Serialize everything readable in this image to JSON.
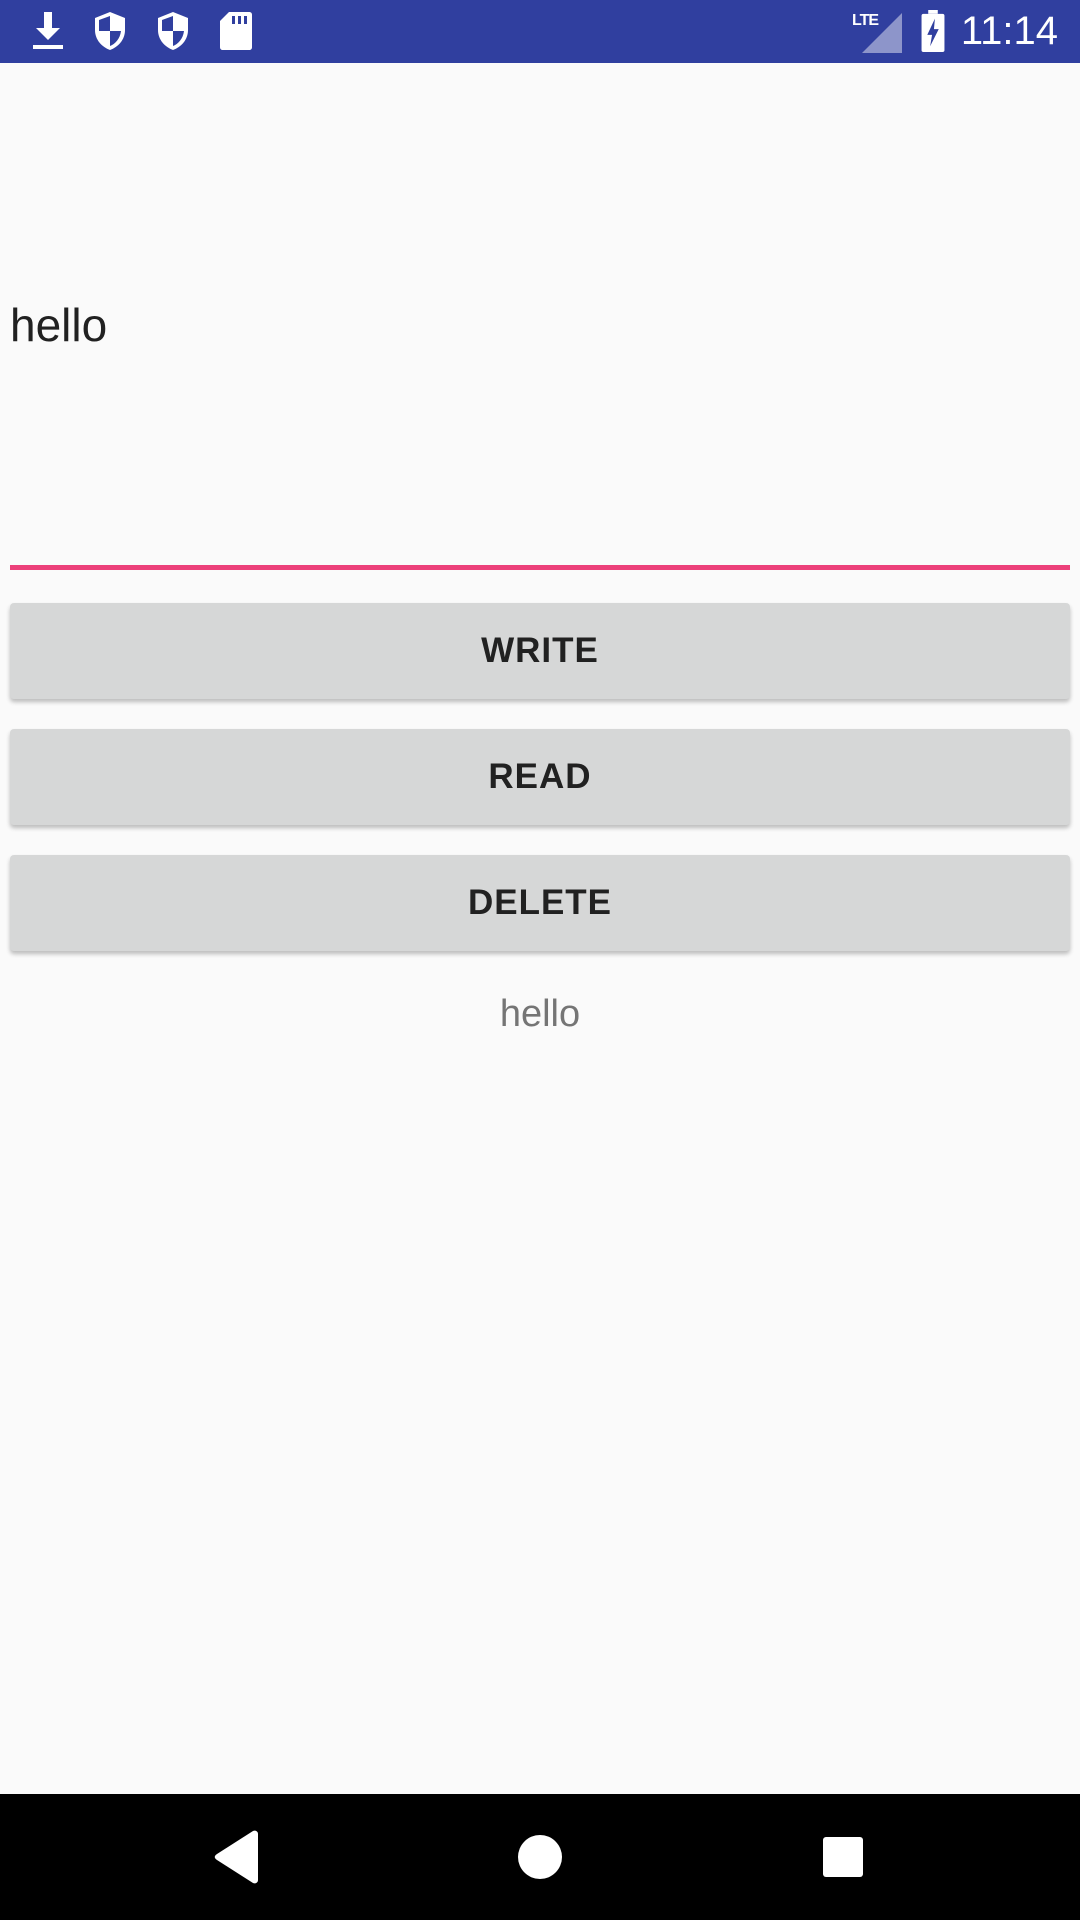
{
  "status_bar": {
    "time": "11:14",
    "network_label": "LTE",
    "left_icons": [
      "download-icon",
      "shield-icon",
      "shield-icon",
      "sd-card-icon"
    ],
    "right_icons": [
      "signal-icon",
      "battery-charging-icon"
    ],
    "background_color": "#303f9f"
  },
  "main": {
    "edit_text": {
      "value": "hello",
      "underline_color": "#ec407a"
    },
    "buttons": [
      {
        "label": "WRITE"
      },
      {
        "label": "READ"
      },
      {
        "label": "DELETE"
      }
    ],
    "result_text": "hello"
  },
  "nav_bar": {
    "icons": [
      "back-icon",
      "home-icon",
      "recents-icon"
    ]
  }
}
